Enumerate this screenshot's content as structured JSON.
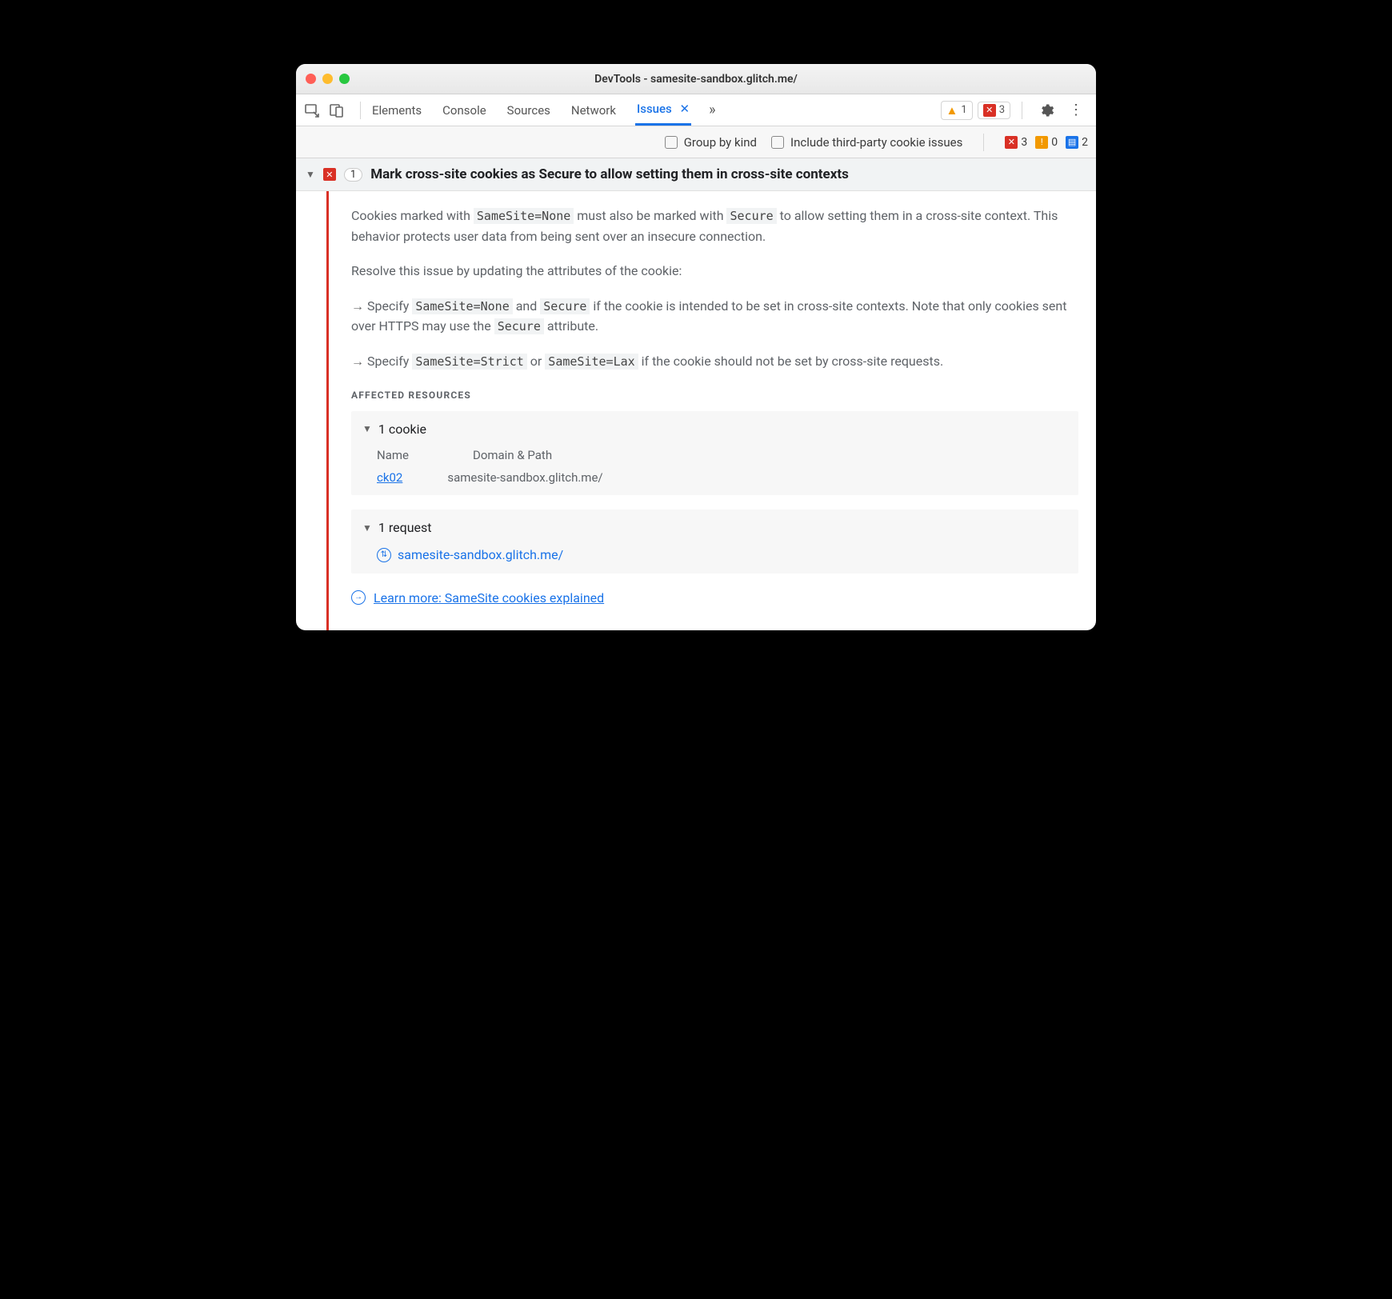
{
  "window_title": "DevTools - samesite-sandbox.glitch.me/",
  "tabs": {
    "elements": "Elements",
    "console": "Console",
    "sources": "Sources",
    "network": "Network",
    "issues": "Issues"
  },
  "toolbar_counts": {
    "warn": "1",
    "err": "3"
  },
  "filter": {
    "group": "Group by kind",
    "third_party": "Include third-party cookie issues",
    "counts": {
      "err": "3",
      "warn": "0",
      "info": "2"
    }
  },
  "issue": {
    "count": "1",
    "title": "Mark cross-site cookies as Secure to allow setting them in cross-site contexts",
    "p1_a": "Cookies marked with ",
    "p1_code1": "SameSite=None",
    "p1_b": " must also be marked with ",
    "p1_code2": "Secure",
    "p1_c": " to allow setting them in a cross-site context. This behavior protects user data from being sent over an insecure connection.",
    "p2": "Resolve this issue by updating the attributes of the cookie:",
    "b1_a": "Specify ",
    "b1_code1": "SameSite=None",
    "b1_b": " and ",
    "b1_code2": "Secure",
    "b1_c": " if the cookie is intended to be set in cross-site contexts. Note that only cookies sent over HTTPS may use the ",
    "b1_code3": "Secure",
    "b1_d": " attribute.",
    "b2_a": "Specify ",
    "b2_code1": "SameSite=Strict",
    "b2_b": " or ",
    "b2_code2": "SameSite=Lax",
    "b2_c": " if the cookie should not be set by cross-site requests."
  },
  "affected": {
    "label": "AFFECTED RESOURCES",
    "cookie_header": "1 cookie",
    "col_name": "Name",
    "col_domain": "Domain & Path",
    "cookie_name": "ck02",
    "cookie_domain": "samesite-sandbox.glitch.me/",
    "request_header": "1 request",
    "request_url": "samesite-sandbox.glitch.me/"
  },
  "learn_more": "Learn more: SameSite cookies explained"
}
